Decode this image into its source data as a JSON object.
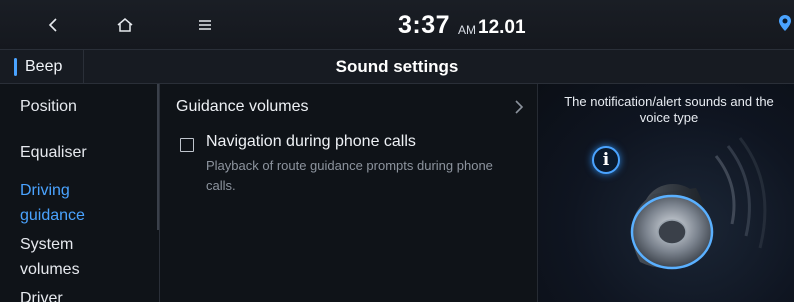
{
  "topbar": {
    "clock": "3:37",
    "ampm": "AM",
    "date": "12.01",
    "icons": {
      "back": "chevron-left-icon",
      "home": "home-icon",
      "menu": "menu-icon",
      "status": "location-status-icon"
    }
  },
  "header": {
    "tab_label": "Beep",
    "title": "Sound settings"
  },
  "sidebar": {
    "items": [
      {
        "label": "Position"
      },
      {
        "label": "Equaliser"
      },
      {
        "label": "Driving\nguidance",
        "active": true
      },
      {
        "label": "System\nvolumes"
      },
      {
        "label": "Driver"
      }
    ]
  },
  "main": {
    "guidance_volumes_label": "Guidance volumes",
    "nav_calls": {
      "label": "Navigation during phone calls",
      "description": "Playback of route guidance prompts during phone calls.",
      "checked": false
    }
  },
  "info_panel": {
    "text": "The notification/alert sounds and the voice type",
    "icon_glyph": "i",
    "accent": "#4aa3ff"
  }
}
